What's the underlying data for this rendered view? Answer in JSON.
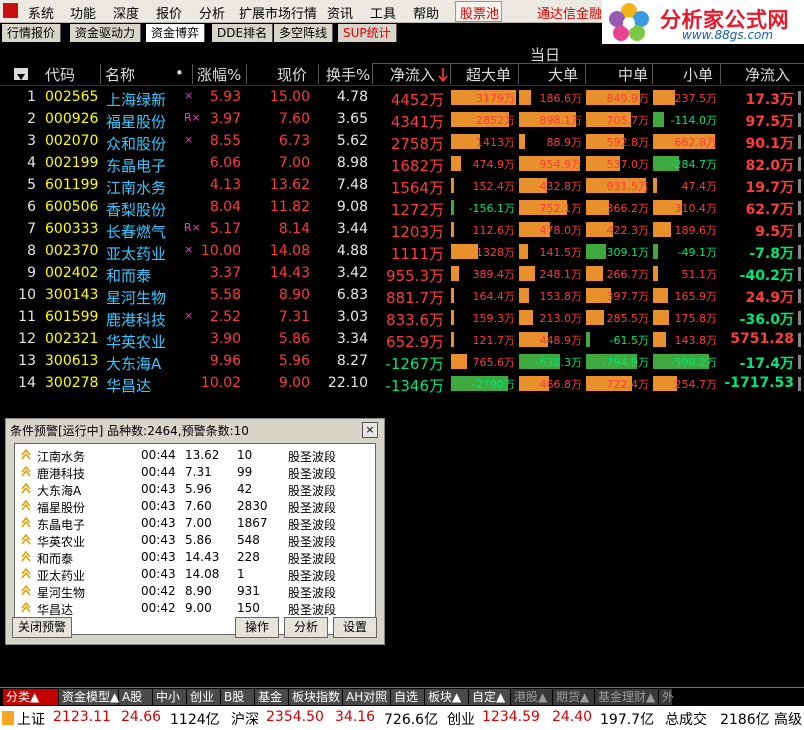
{
  "menu": {
    "items": [
      "系统",
      "功能",
      "深度",
      "报价",
      "分析",
      "扩展市场行情",
      "资讯",
      "工具",
      "帮助"
    ],
    "pool_label": "股票池",
    "ad": "通达信金融终"
  },
  "logo": {
    "title": "分析家公式网",
    "url": "www.88gs.com"
  },
  "tabs": [
    "行情报价",
    "资金驱动力",
    "资金博弈",
    "DDE排名",
    "多空阵线",
    "SUP统计"
  ],
  "grid": {
    "group_label": "当日",
    "headers": {
      "code": "代码",
      "name": "名称",
      "dot": "•",
      "pct": "涨幅%",
      "price": "现价",
      "turnover": "换手%",
      "netflow": "净流入",
      "huge": "超大单",
      "large": "大单",
      "mid": "中单",
      "small": "小单",
      "netflow2": "净流入"
    },
    "rows": [
      {
        "idx": "1",
        "code": "002565",
        "name": "上海绿新",
        "flag": "×",
        "pct": "5.93",
        "price": "15.00",
        "turn": "4.78",
        "net": "4452万",
        "huge": "3179万",
        "hugev": 3179,
        "large": "186.6万",
        "largev": 186.6,
        "mid": "849.9万",
        "midv": 849.9,
        "small": "237.5万",
        "smallv": 237.5,
        "net2": "17.3万",
        "net2v": 17.3
      },
      {
        "idx": "2",
        "code": "000926",
        "name": "福星股份",
        "flag": "R×",
        "pct": "3.97",
        "price": "7.60",
        "turn": "3.65",
        "net": "4341万",
        "huge": "2852万",
        "hugev": 2852,
        "large": "898.1万",
        "largev": 898.1,
        "mid": "705.7万",
        "midv": 705.7,
        "small": "-114.0万",
        "smallv": -114.0,
        "net2": "97.5万",
        "net2v": 97.5
      },
      {
        "idx": "3",
        "code": "002070",
        "name": "众和股份",
        "flag": "×",
        "pct": "8.55",
        "price": "6.73",
        "turn": "5.62",
        "net": "2758万",
        "huge": "1413万",
        "hugev": 1413,
        "large": "88.9万",
        "largev": 88.9,
        "mid": "592.8万",
        "midv": 592.8,
        "small": "662.8万",
        "smallv": 662.8,
        "net2": "90.1万",
        "net2v": 90.1
      },
      {
        "idx": "4",
        "code": "002199",
        "name": "东晶电子",
        "flag": "",
        "pct": "6.06",
        "price": "7.00",
        "turn": "8.98",
        "net": "1682万",
        "huge": "474.9万",
        "hugev": 474.9,
        "large": "954.9万",
        "largev": 954.9,
        "mid": "537.0万",
        "midv": 537.0,
        "small": "-284.7万",
        "smallv": -284.7,
        "net2": "82.0万",
        "net2v": 82.0
      },
      {
        "idx": "5",
        "code": "601199",
        "name": "江南水务",
        "flag": "",
        "pct": "4.13",
        "price": "13.62",
        "turn": "7.48",
        "net": "1564万",
        "huge": "152.4万",
        "hugev": 152.4,
        "large": "432.8万",
        "largev": 432.8,
        "mid": "931.5万",
        "midv": 931.5,
        "small": "47.4万",
        "smallv": 47.4,
        "net2": "19.7万",
        "net2v": 19.7
      },
      {
        "idx": "6",
        "code": "600506",
        "name": "香梨股份",
        "flag": "",
        "pct": "8.04",
        "price": "11.82",
        "turn": "9.08",
        "net": "1272万",
        "huge": "-156.1万",
        "hugev": -156.1,
        "large": "752.1万",
        "largev": 752.1,
        "mid": "366.2万",
        "midv": 366.2,
        "small": "310.4万",
        "smallv": 310.4,
        "net2": "62.7万",
        "net2v": 62.7
      },
      {
        "idx": "7",
        "code": "600333",
        "name": "长春燃气",
        "flag": "R×",
        "pct": "5.17",
        "price": "8.14",
        "turn": "3.44",
        "net": "1203万",
        "huge": "112.6万",
        "hugev": 112.6,
        "large": "478.0万",
        "largev": 478.0,
        "mid": "422.3万",
        "midv": 422.3,
        "small": "189.6万",
        "smallv": 189.6,
        "net2": "9.5万",
        "net2v": 9.5
      },
      {
        "idx": "8",
        "code": "002370",
        "name": "亚太药业",
        "flag": "×",
        "pct": "10.00",
        "price": "14.08",
        "turn": "4.88",
        "net": "1111万",
        "huge": "1328万",
        "hugev": 1328,
        "large": "141.5万",
        "largev": 141.5,
        "mid": "-309.1万",
        "midv": -309.1,
        "small": "-49.1万",
        "smallv": -49.1,
        "net2": "-7.8万",
        "net2v": -7.8
      },
      {
        "idx": "9",
        "code": "002402",
        "name": "和而泰",
        "flag": "",
        "pct": "3.37",
        "price": "14.43",
        "turn": "3.42",
        "net": "955.3万",
        "huge": "389.4万",
        "hugev": 389.4,
        "large": "248.1万",
        "largev": 248.1,
        "mid": "266.7万",
        "midv": 266.7,
        "small": "51.1万",
        "smallv": 51.1,
        "net2": "-40.2万",
        "net2v": -40.2
      },
      {
        "idx": "10",
        "code": "300143",
        "name": "星河生物",
        "flag": "",
        "pct": "5.58",
        "price": "8.90",
        "turn": "6.83",
        "net": "881.7万",
        "huge": "164.4万",
        "hugev": 164.4,
        "large": "153.8万",
        "largev": 153.8,
        "mid": "397.7万",
        "midv": 397.7,
        "small": "165.9万",
        "smallv": 165.9,
        "net2": "24.9万",
        "net2v": 24.9
      },
      {
        "idx": "11",
        "code": "601599",
        "name": "鹿港科技",
        "flag": "×",
        "pct": "2.52",
        "price": "7.31",
        "turn": "3.03",
        "net": "833.6万",
        "huge": "159.3万",
        "hugev": 159.3,
        "large": "213.0万",
        "largev": 213.0,
        "mid": "285.5万",
        "midv": 285.5,
        "small": "175.8万",
        "smallv": 175.8,
        "net2": "-36.0万",
        "net2v": -36.0
      },
      {
        "idx": "12",
        "code": "002321",
        "name": "华英农业",
        "flag": "",
        "pct": "3.90",
        "price": "5.86",
        "turn": "3.34",
        "net": "652.9万",
        "huge": "121.7万",
        "hugev": 121.7,
        "large": "448.9万",
        "largev": 448.9,
        "mid": "-61.5万",
        "midv": -61.5,
        "small": "143.8万",
        "smallv": 143.8,
        "net2": "5751.28",
        "net2v": 5751.28
      },
      {
        "idx": "13",
        "code": "300613",
        "name": "大东海A",
        "flag": "",
        "pct": "9.96",
        "price": "5.96",
        "turn": "8.27",
        "net": "-1267万",
        "huge": "765.6万",
        "hugev": 765.6,
        "large": "-638.3万",
        "largev": -638.3,
        "mid": "-794.9万",
        "midv": -794.9,
        "small": "-599.2万",
        "smallv": -599.2,
        "net2": "-17.4万",
        "net2v": -17.4
      },
      {
        "idx": "14",
        "code": "300278",
        "name": "华昌达",
        "flag": "",
        "pct": "10.02",
        "price": "9.00",
        "turn": "22.10",
        "net": "-1346万",
        "huge": "-2790万",
        "hugev": -2790,
        "large": "466.8万",
        "largev": 466.8,
        "mid": "722.4万",
        "midv": 722.4,
        "small": "254.7万",
        "smallv": 254.7,
        "net2": "-1717.53",
        "net2v": -1717.53
      }
    ]
  },
  "alert": {
    "title": "条件预警[运行中] 品种数:2464,预警条数:10",
    "close": "×",
    "rows": [
      {
        "name": "江南水务",
        "time": "00:44",
        "price": "13.62",
        "vol": "10",
        "rule": "股圣波段"
      },
      {
        "name": "鹿港科技",
        "time": "00:44",
        "price": "7.31",
        "vol": "99",
        "rule": "股圣波段"
      },
      {
        "name": "大东海A",
        "time": "00:43",
        "price": "5.96",
        "vol": "42",
        "rule": "股圣波段"
      },
      {
        "name": "福星股份",
        "time": "00:43",
        "price": "7.60",
        "vol": "2830",
        "rule": "股圣波段"
      },
      {
        "name": "东晶电子",
        "time": "00:43",
        "price": "7.00",
        "vol": "1867",
        "rule": "股圣波段"
      },
      {
        "name": "华英农业",
        "time": "00:43",
        "price": "5.86",
        "vol": "548",
        "rule": "股圣波段"
      },
      {
        "name": "和而泰",
        "time": "00:43",
        "price": "14.43",
        "vol": "228",
        "rule": "股圣波段"
      },
      {
        "name": "亚太药业",
        "time": "00:43",
        "price": "14.08",
        "vol": "1",
        "rule": "股圣波段"
      },
      {
        "name": "星河生物",
        "time": "00:42",
        "price": "8.90",
        "vol": "931",
        "rule": "股圣波段"
      },
      {
        "name": "华昌达",
        "time": "00:42",
        "price": "9.00",
        "vol": "150",
        "rule": "股圣波段"
      }
    ],
    "buttons": {
      "close_alert": "关闭预警",
      "operate": "操作",
      "analyze": "分析",
      "settings": "设置"
    }
  },
  "bottom_tabs": [
    "分类▲",
    "资金模型▲",
    "A股",
    "中小",
    "创业",
    "B股",
    "基金",
    "板块指数",
    "AH对照",
    "自选",
    "板块▲",
    "自定▲",
    "港股▲",
    "期货▲",
    "基金理财▲",
    "外"
  ],
  "status": {
    "sh_label": "上证",
    "sh_value": "2123.11",
    "sh_change": "24.66",
    "sh_amount": "1124亿",
    "hs_label": "沪深",
    "hs_value": "2354.50",
    "hs_change": "34.16",
    "hs_amount": "726.6亿",
    "cy_label": "创业",
    "cy_value": "1234.59",
    "cy_change": "24.40",
    "cy_amount": "197.7亿",
    "total_label": "总成交",
    "total_value": "2186亿",
    "extra": "高级"
  },
  "colors": {
    "up": "#ff3b3b",
    "down": "#00e676",
    "bar_pos": "#e8902c",
    "bar_neg": "#3fa83f",
    "name": "#38c8ff",
    "code": "#ffff00"
  }
}
